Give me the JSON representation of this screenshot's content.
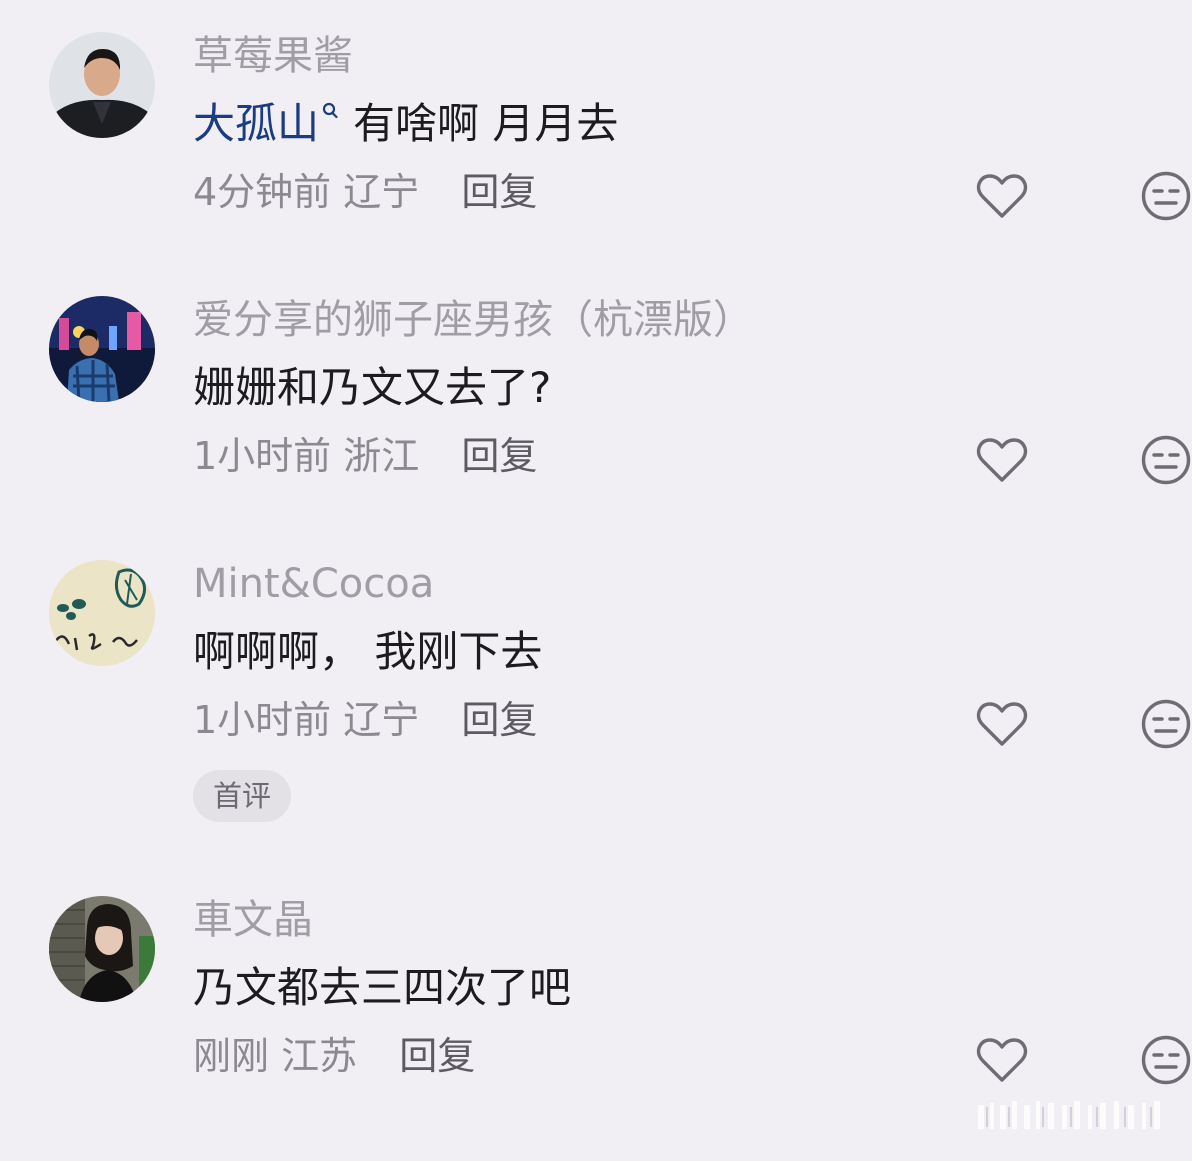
{
  "comments": [
    {
      "username": "草莓果酱",
      "mention": "大孤山",
      "text": "有啥啊 月月去",
      "time": "4分钟前",
      "location": "辽宁",
      "reply_label": "回复"
    },
    {
      "username": "爱分享的狮子座男孩（杭漂版）",
      "text": "姗姗和乃文又去了?",
      "time": "1小时前",
      "location": "浙江",
      "reply_label": "回复"
    },
    {
      "username": "Mint&Cocoa",
      "text": "啊啊啊， 我刚下去",
      "time": "1小时前",
      "location": "辽宁",
      "reply_label": "回复",
      "badge": "首评"
    },
    {
      "username": "車文晶",
      "text": "乃文都去三四次了吧",
      "time": "刚刚",
      "location": "江苏",
      "reply_label": "回复"
    }
  ],
  "icons": {
    "like": "heart-outline-icon",
    "dislike": "neutral-face-icon",
    "mention": "search-icon"
  },
  "colors": {
    "background": "#f1eff4",
    "mention": "#1a3c83",
    "username": "#a09ea5"
  }
}
